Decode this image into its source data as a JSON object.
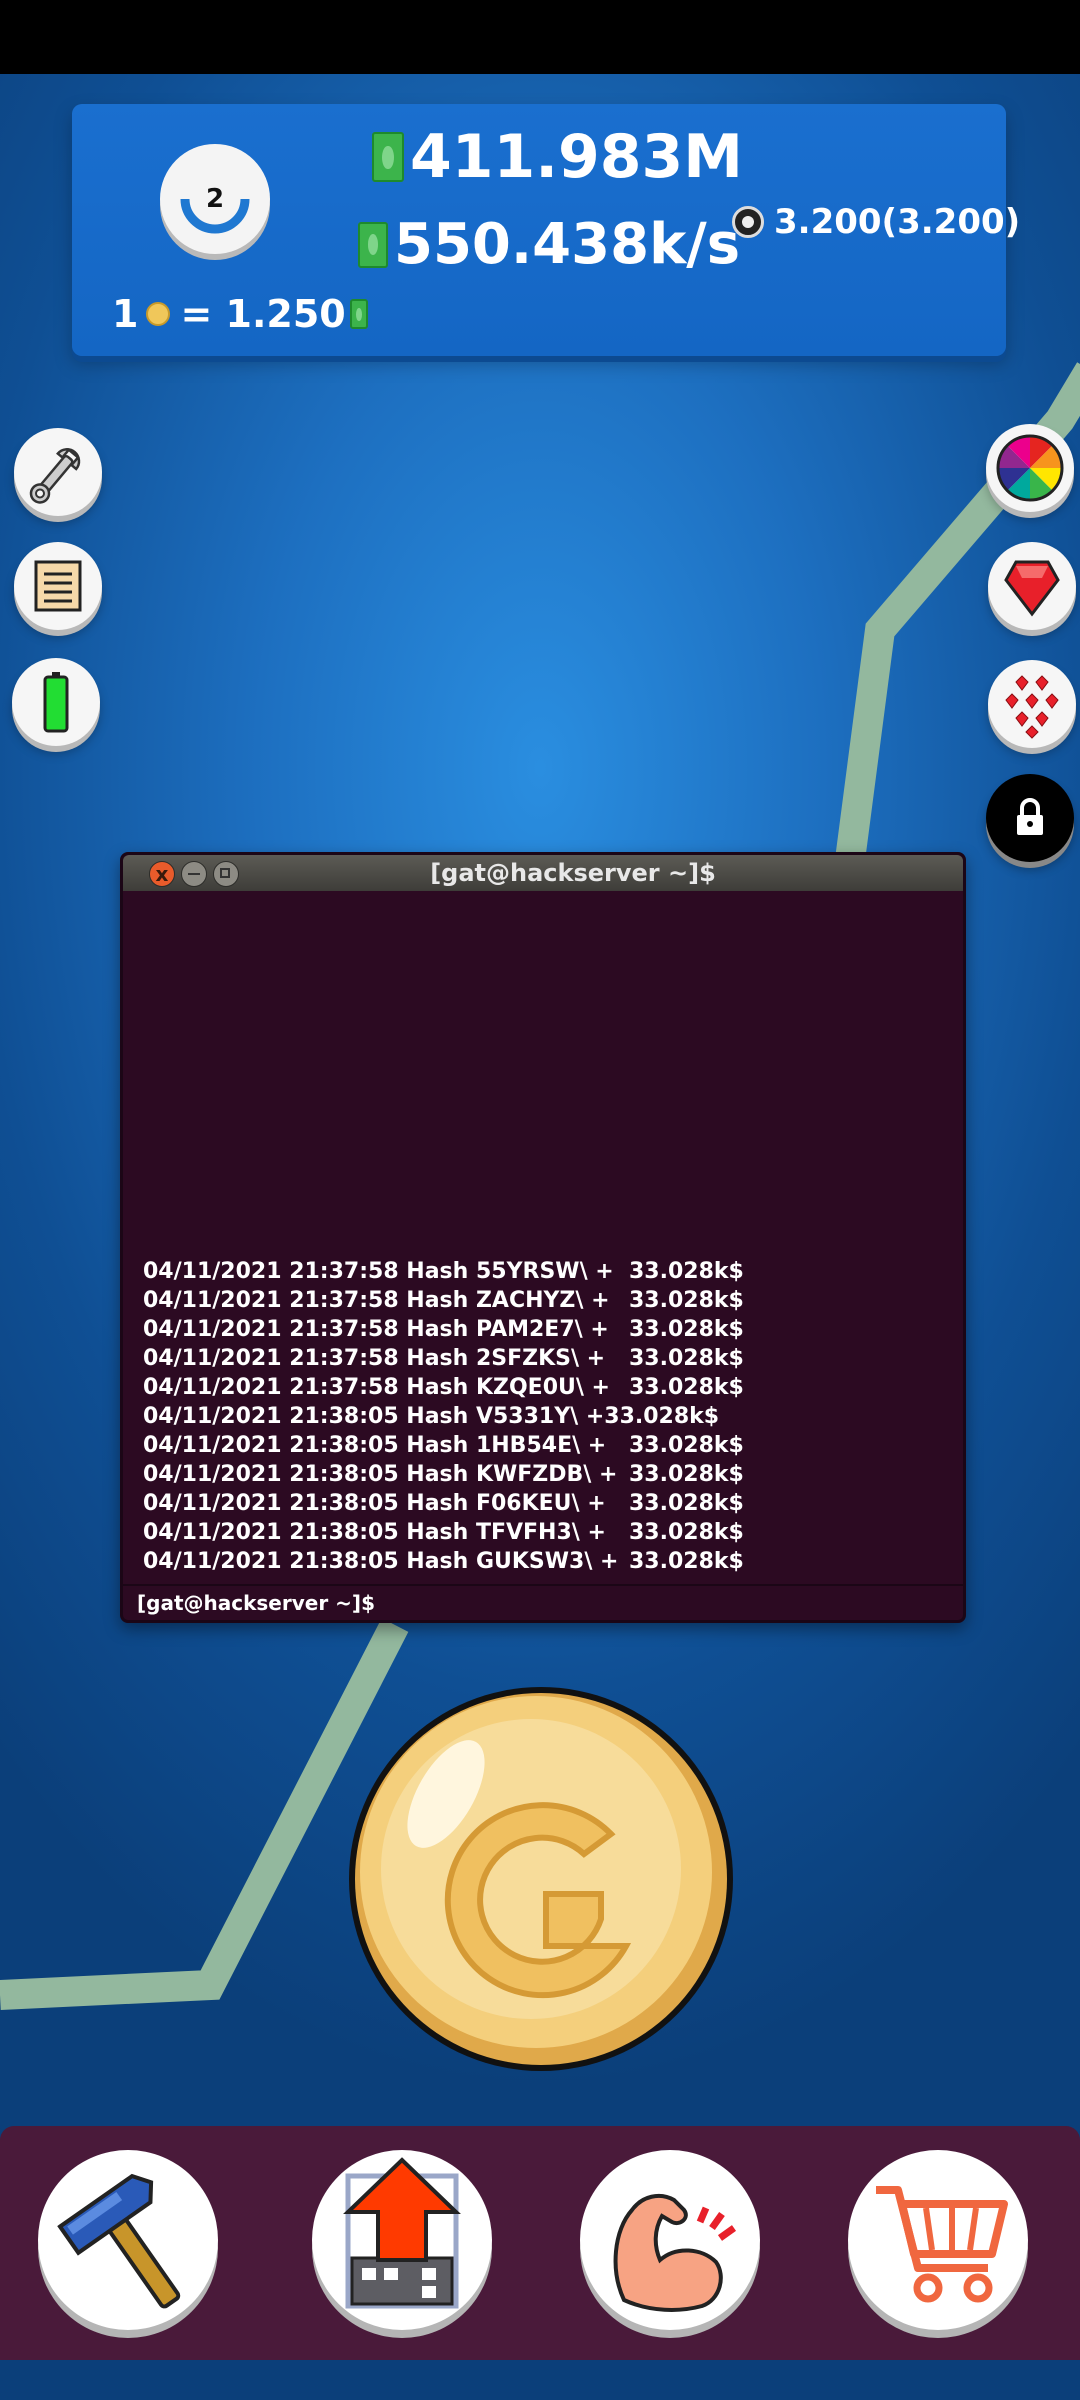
{
  "header": {
    "level": "2",
    "money": "411.983M",
    "rate": "550.438k/s",
    "multiplier": "3.200(3.200)",
    "exchange": "1",
    "exchange_value": "= 1.250"
  },
  "side_left": [
    {
      "name": "wrench-icon"
    },
    {
      "name": "notes-icon"
    },
    {
      "name": "battery-icon"
    }
  ],
  "side_right": [
    {
      "name": "color-wheel-icon"
    },
    {
      "name": "ruby-icon"
    },
    {
      "name": "gems-icon"
    },
    {
      "name": "lock-icon"
    }
  ],
  "terminal": {
    "title": "[gat@hackserver ~]$",
    "prompt": "[gat@hackserver ~]$",
    "log": [
      {
        "text": "04/11/2021 21:37:58 Hash 55YRSW\\ +",
        "amount": "33.028k$"
      },
      {
        "text": "04/11/2021 21:37:58 Hash ZACHYZ\\ +",
        "amount": "33.028k$"
      },
      {
        "text": "04/11/2021 21:37:58 Hash PAM2E7\\ +",
        "amount": "33.028k$"
      },
      {
        "text": "04/11/2021 21:37:58 Hash 2SFZKS\\ +",
        "amount": "33.028k$"
      },
      {
        "text": "04/11/2021 21:37:58 Hash KZQE0U\\ +",
        "amount": "33.028k$"
      },
      {
        "text": "04/11/2021 21:38:05 Hash V5331Y\\ +33.028k$",
        "amount": ""
      },
      {
        "text": "04/11/2021 21:38:05 Hash 1HB54E\\ +",
        "amount": "33.028k$"
      },
      {
        "text": "04/11/2021 21:38:05 Hash KWFZDB\\ +",
        "amount": "33.028k$"
      },
      {
        "text": "04/11/2021 21:38:05 Hash F06KEU\\ +",
        "amount": "33.028k$"
      },
      {
        "text": "04/11/2021 21:38:05 Hash TFVFH3\\ +",
        "amount": "33.028k$"
      },
      {
        "text": "04/11/2021 21:38:05 Hash GUKSW3\\ +",
        "amount": "33.028k$"
      }
    ]
  },
  "bottom_nav": [
    {
      "name": "hammer-icon"
    },
    {
      "name": "upgrade-building-icon"
    },
    {
      "name": "muscle-icon"
    },
    {
      "name": "cart-icon"
    }
  ],
  "colors": {
    "accent": "#1466c4",
    "terminal_bg": "#2c0a22",
    "bottom_bar": "#4a1a3a",
    "money_green": "#3cb44b",
    "coin_gold": "#f0c75a"
  }
}
